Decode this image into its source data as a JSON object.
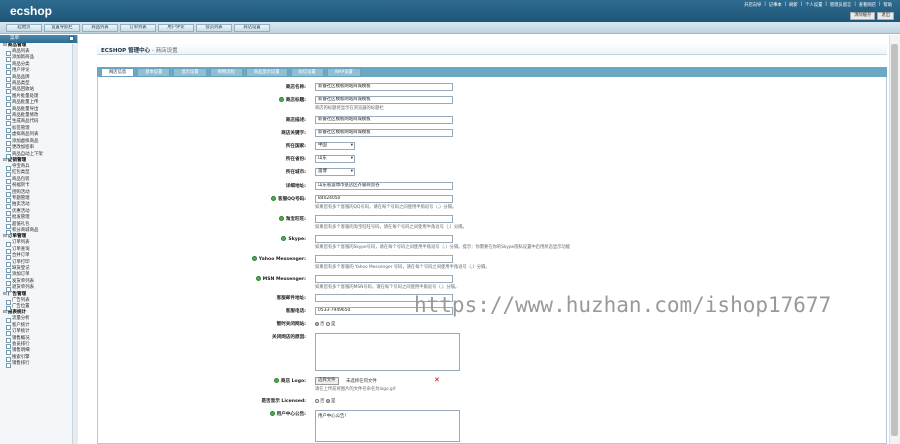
{
  "header": {
    "logo": "ecshop",
    "links": [
      "开店向导",
      "|",
      "记事本",
      "|",
      "刷新",
      "|",
      "个人设置",
      "|",
      "管理员留言",
      "|",
      "查看网店",
      "|",
      "帮助"
    ],
    "buttons": [
      "清除缓存",
      "退出"
    ]
  },
  "nav": {
    "items": [
      "起始页",
      "设置导航栏",
      "商品列表",
      "订单列表",
      "用户评论",
      "会员列表",
      "商店设置"
    ]
  },
  "sidebar": {
    "title": "菜单",
    "groups": [
      {
        "label": "商品管理",
        "items": [
          "商品列表",
          "添加新商品",
          "商品分类",
          "用户评论",
          "商品品牌",
          "商品类型",
          "商品回收站",
          "图片批量处理",
          "商品批量上传",
          "商品批量导出",
          "商品批量修改",
          "生成商品代码",
          "标签管理",
          "虚拟商品列表",
          "添加虚拟商品",
          "更改加密串",
          "商品自动上下架"
        ]
      },
      {
        "label": "促销管理",
        "items": [
          "夺宝奇兵",
          "红包类型",
          "商品包装",
          "祝福贺卡",
          "团购活动",
          "专题管理",
          "拍卖活动",
          "优惠活动",
          "批发管理",
          "超值礼包",
          "积分商城商品"
        ]
      },
      {
        "label": "订单管理",
        "items": [
          "订单列表",
          "订单查询",
          "合并订单",
          "订单打印",
          "缺货登记",
          "添加订单",
          "发货单列表",
          "退货单列表"
        ]
      },
      {
        "label": "广告管理",
        "items": [
          "广告列表",
          "广告位置"
        ]
      },
      {
        "label": "报表统计",
        "items": [
          "流量分析",
          "客户统计",
          "订单统计",
          "销售概况",
          "会员排行",
          "销售明细",
          "搜索引擎",
          "销售排行"
        ]
      }
    ]
  },
  "main": {
    "title": "ECSHOP 管理中心",
    "subtitle": " - 商店设置",
    "tabs": [
      "网店信息",
      "基本设置",
      "显示设置",
      "购物流程",
      "商品显示设置",
      "短信设置",
      "WAP设置"
    ],
    "fields": {
      "shop_name": {
        "label": "商店名称:",
        "value": "新睿社区模板网站商城模板"
      },
      "shop_title": {
        "label": "商店标题:",
        "value": "新睿社区模板网站商城模板",
        "hint": "商店的标题将显示在浏览器的标题栏"
      },
      "shop_desc": {
        "label": "商店描述:",
        "value": "新睿社区模板网站商城模板"
      },
      "shop_keywords": {
        "label": "商店关键字:",
        "value": "新睿社区模板网站商城模板"
      },
      "country": {
        "label": "所在国家:",
        "value": "中国"
      },
      "province": {
        "label": "所在省份:",
        "value": "山东"
      },
      "city": {
        "label": "所在城市:",
        "value": "淄博"
      },
      "address": {
        "label": "详细地址:",
        "value": "山东省淄博市张店区齐鲁商贸谷"
      },
      "qq": {
        "label": "客服QQ号码:",
        "value": "84024050",
        "hint": "如果您有多个客服的QQ号码，请在每个号码之间使用半角逗号（,）分隔。"
      },
      "ww": {
        "label": "淘宝旺旺:",
        "value": "",
        "hint": "如果您有多个客服的淘宝旺旺号码，请在每个号码之间使用半角逗号（,）分隔。"
      },
      "skype": {
        "label": "Skype:",
        "value": "",
        "hint": "如果您有多个客服的Skype号码，请在每个号码之间使用半角逗号（,）分隔。提示：你需要在你的Skype隐私设置中启用状态显示功能"
      },
      "ym": {
        "label": "Yahoo Messenger:",
        "value": "",
        "hint": "如果您有多个客服的 Yahoo Messenger 号码，请在每个号码之间使用半角逗号（,）分隔。"
      },
      "msn": {
        "label": "MSN Messenger:",
        "value": "",
        "hint": "如果您有多个客服的MSN号码，请在每个号码之间使用半角逗号（,）分隔。"
      },
      "email": {
        "label": "客服邮件地址:",
        "value": ""
      },
      "phone": {
        "label": "客服电话:",
        "value": "0533-7949650"
      },
      "closed": {
        "label": "暂时关闭网站:",
        "yes": "是",
        "no": "否"
      },
      "close_comment": {
        "label": "关闭网店的原因:",
        "value": ""
      },
      "logo": {
        "label": "商店 Logo:",
        "button": "选择文件",
        "file": "未选择任何文件",
        "hint": "请在上传前将图片的文件名命名为logo.gif"
      },
      "licensed": {
        "label": "是否显示 Licensed:",
        "yes": "是",
        "no": "否"
      },
      "user_notice": {
        "label": "用户中心公告:",
        "value": "用户中心公告!"
      }
    }
  },
  "watermark": "https://www.huzhan.com/ishop17677"
}
